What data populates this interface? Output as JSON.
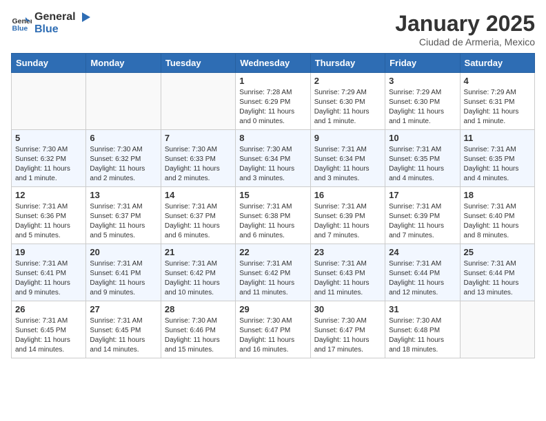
{
  "header": {
    "logo": {
      "general": "General",
      "blue": "Blue"
    },
    "title": "January 2025",
    "subtitle": "Ciudad de Armeria, Mexico"
  },
  "days_of_week": [
    "Sunday",
    "Monday",
    "Tuesday",
    "Wednesday",
    "Thursday",
    "Friday",
    "Saturday"
  ],
  "weeks": [
    [
      {
        "day": "",
        "info": ""
      },
      {
        "day": "",
        "info": ""
      },
      {
        "day": "",
        "info": ""
      },
      {
        "day": "1",
        "info": "Sunrise: 7:28 AM\nSunset: 6:29 PM\nDaylight: 11 hours\nand 0 minutes."
      },
      {
        "day": "2",
        "info": "Sunrise: 7:29 AM\nSunset: 6:30 PM\nDaylight: 11 hours\nand 1 minute."
      },
      {
        "day": "3",
        "info": "Sunrise: 7:29 AM\nSunset: 6:30 PM\nDaylight: 11 hours\nand 1 minute."
      },
      {
        "day": "4",
        "info": "Sunrise: 7:29 AM\nSunset: 6:31 PM\nDaylight: 11 hours\nand 1 minute."
      }
    ],
    [
      {
        "day": "5",
        "info": "Sunrise: 7:30 AM\nSunset: 6:32 PM\nDaylight: 11 hours\nand 1 minute."
      },
      {
        "day": "6",
        "info": "Sunrise: 7:30 AM\nSunset: 6:32 PM\nDaylight: 11 hours\nand 2 minutes."
      },
      {
        "day": "7",
        "info": "Sunrise: 7:30 AM\nSunset: 6:33 PM\nDaylight: 11 hours\nand 2 minutes."
      },
      {
        "day": "8",
        "info": "Sunrise: 7:30 AM\nSunset: 6:34 PM\nDaylight: 11 hours\nand 3 minutes."
      },
      {
        "day": "9",
        "info": "Sunrise: 7:31 AM\nSunset: 6:34 PM\nDaylight: 11 hours\nand 3 minutes."
      },
      {
        "day": "10",
        "info": "Sunrise: 7:31 AM\nSunset: 6:35 PM\nDaylight: 11 hours\nand 4 minutes."
      },
      {
        "day": "11",
        "info": "Sunrise: 7:31 AM\nSunset: 6:35 PM\nDaylight: 11 hours\nand 4 minutes."
      }
    ],
    [
      {
        "day": "12",
        "info": "Sunrise: 7:31 AM\nSunset: 6:36 PM\nDaylight: 11 hours\nand 5 minutes."
      },
      {
        "day": "13",
        "info": "Sunrise: 7:31 AM\nSunset: 6:37 PM\nDaylight: 11 hours\nand 5 minutes."
      },
      {
        "day": "14",
        "info": "Sunrise: 7:31 AM\nSunset: 6:37 PM\nDaylight: 11 hours\nand 6 minutes."
      },
      {
        "day": "15",
        "info": "Sunrise: 7:31 AM\nSunset: 6:38 PM\nDaylight: 11 hours\nand 6 minutes."
      },
      {
        "day": "16",
        "info": "Sunrise: 7:31 AM\nSunset: 6:39 PM\nDaylight: 11 hours\nand 7 minutes."
      },
      {
        "day": "17",
        "info": "Sunrise: 7:31 AM\nSunset: 6:39 PM\nDaylight: 11 hours\nand 7 minutes."
      },
      {
        "day": "18",
        "info": "Sunrise: 7:31 AM\nSunset: 6:40 PM\nDaylight: 11 hours\nand 8 minutes."
      }
    ],
    [
      {
        "day": "19",
        "info": "Sunrise: 7:31 AM\nSunset: 6:41 PM\nDaylight: 11 hours\nand 9 minutes."
      },
      {
        "day": "20",
        "info": "Sunrise: 7:31 AM\nSunset: 6:41 PM\nDaylight: 11 hours\nand 9 minutes."
      },
      {
        "day": "21",
        "info": "Sunrise: 7:31 AM\nSunset: 6:42 PM\nDaylight: 11 hours\nand 10 minutes."
      },
      {
        "day": "22",
        "info": "Sunrise: 7:31 AM\nSunset: 6:42 PM\nDaylight: 11 hours\nand 11 minutes."
      },
      {
        "day": "23",
        "info": "Sunrise: 7:31 AM\nSunset: 6:43 PM\nDaylight: 11 hours\nand 11 minutes."
      },
      {
        "day": "24",
        "info": "Sunrise: 7:31 AM\nSunset: 6:44 PM\nDaylight: 11 hours\nand 12 minutes."
      },
      {
        "day": "25",
        "info": "Sunrise: 7:31 AM\nSunset: 6:44 PM\nDaylight: 11 hours\nand 13 minutes."
      }
    ],
    [
      {
        "day": "26",
        "info": "Sunrise: 7:31 AM\nSunset: 6:45 PM\nDaylight: 11 hours\nand 14 minutes."
      },
      {
        "day": "27",
        "info": "Sunrise: 7:31 AM\nSunset: 6:45 PM\nDaylight: 11 hours\nand 14 minutes."
      },
      {
        "day": "28",
        "info": "Sunrise: 7:30 AM\nSunset: 6:46 PM\nDaylight: 11 hours\nand 15 minutes."
      },
      {
        "day": "29",
        "info": "Sunrise: 7:30 AM\nSunset: 6:47 PM\nDaylight: 11 hours\nand 16 minutes."
      },
      {
        "day": "30",
        "info": "Sunrise: 7:30 AM\nSunset: 6:47 PM\nDaylight: 11 hours\nand 17 minutes."
      },
      {
        "day": "31",
        "info": "Sunrise: 7:30 AM\nSunset: 6:48 PM\nDaylight: 11 hours\nand 18 minutes."
      },
      {
        "day": "",
        "info": ""
      }
    ]
  ]
}
